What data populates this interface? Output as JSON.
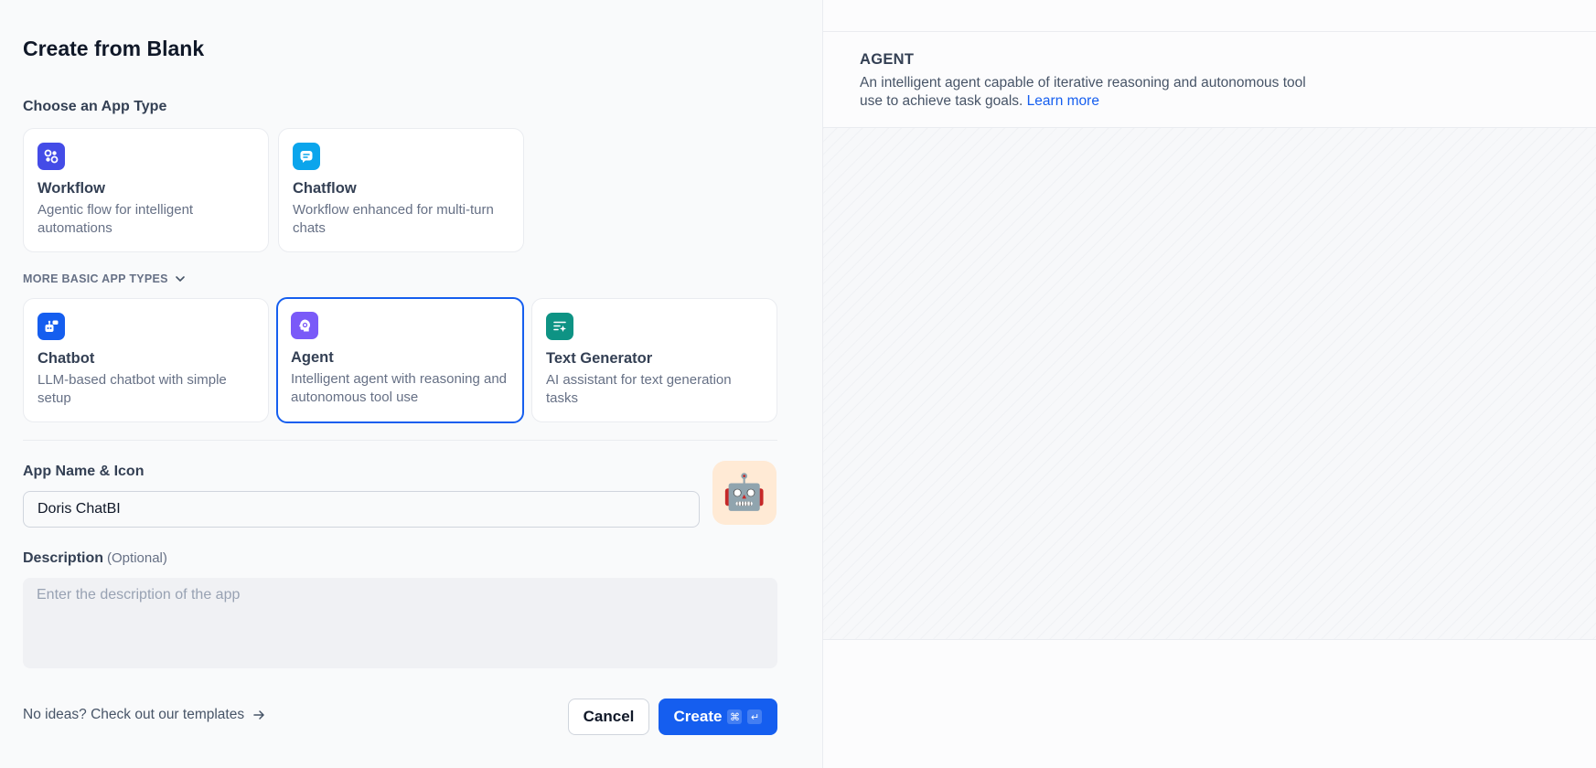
{
  "page": {
    "title": "Create from Blank"
  },
  "app_type": {
    "label": "Choose an App Type",
    "primary_cards": [
      {
        "title": "Workflow",
        "description": "Agentic flow for intelligent automations",
        "icon": "workflow-icon",
        "color": "#444ce7"
      },
      {
        "title": "Chatflow",
        "description": "Workflow enhanced for multi-turn chats",
        "icon": "chatflow-icon",
        "color": "#0ba5ec"
      }
    ],
    "more_label": "MORE BASIC APP TYPES",
    "basic_cards": [
      {
        "title": "Chatbot",
        "description": "LLM-based chatbot with simple setup",
        "icon": "chatbot-icon",
        "color": "#155eef"
      },
      {
        "title": "Agent",
        "description": "Intelligent agent with reasoning and autonomous tool use",
        "icon": "agent-icon",
        "color": "#7a5af8",
        "selected": true
      },
      {
        "title": "Text Generator",
        "description": "AI assistant for text generation tasks",
        "icon": "text-generator-icon",
        "color": "#0e9384"
      }
    ]
  },
  "app_name": {
    "label": "App Name & Icon",
    "value": "Doris ChatBI",
    "avatar_emoji": "🤖",
    "avatar_bg": "#ffead5"
  },
  "description": {
    "label": "Description",
    "optional": "(Optional)",
    "placeholder": "Enter the description of the app"
  },
  "footer": {
    "templates_link": "No ideas? Check out our templates",
    "cancel_label": "Cancel",
    "create_label": "Create",
    "shortcut_cmd": "⌘",
    "shortcut_enter": "↵"
  },
  "preview": {
    "type": "AGENT",
    "description": "An intelligent agent capable of iterative reasoning and autonomous tool use to achieve task goals.",
    "learn_more": "Learn more"
  },
  "colors": {
    "accent": "#155eef",
    "border": "#eaecf0"
  }
}
